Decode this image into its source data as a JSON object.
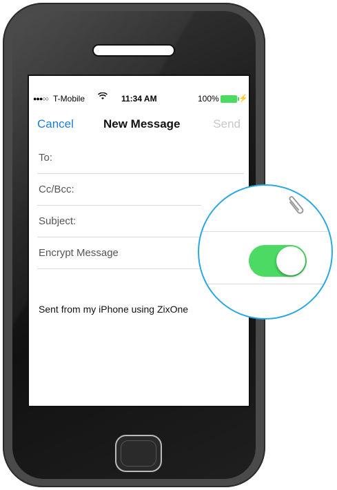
{
  "status_bar": {
    "signal": "●●●○○",
    "carrier": "T-Mobile",
    "wifi_icon": "wifi-icon",
    "time": "11:34 AM",
    "battery": "100%",
    "charge_icon": "charge-icon",
    "battery_level": 1.0
  },
  "nav": {
    "cancel": "Cancel",
    "title": "New Message",
    "send": "Send"
  },
  "fields": {
    "to": "To:",
    "cc_bcc": "Cc/Bcc:",
    "subject": "Subject:",
    "encrypt": "Encrypt Message"
  },
  "body_text": "Sent from my iPhone using ZixOne",
  "zoom": {
    "attachment_icon": "paperclip-icon",
    "encrypt_toggle_on": true
  },
  "colors": {
    "accent": "#1f7cd8",
    "toggle_on": "#4cd964",
    "zoom_ring": "#29a7e1",
    "send_disabled": "#c7c7cc"
  }
}
